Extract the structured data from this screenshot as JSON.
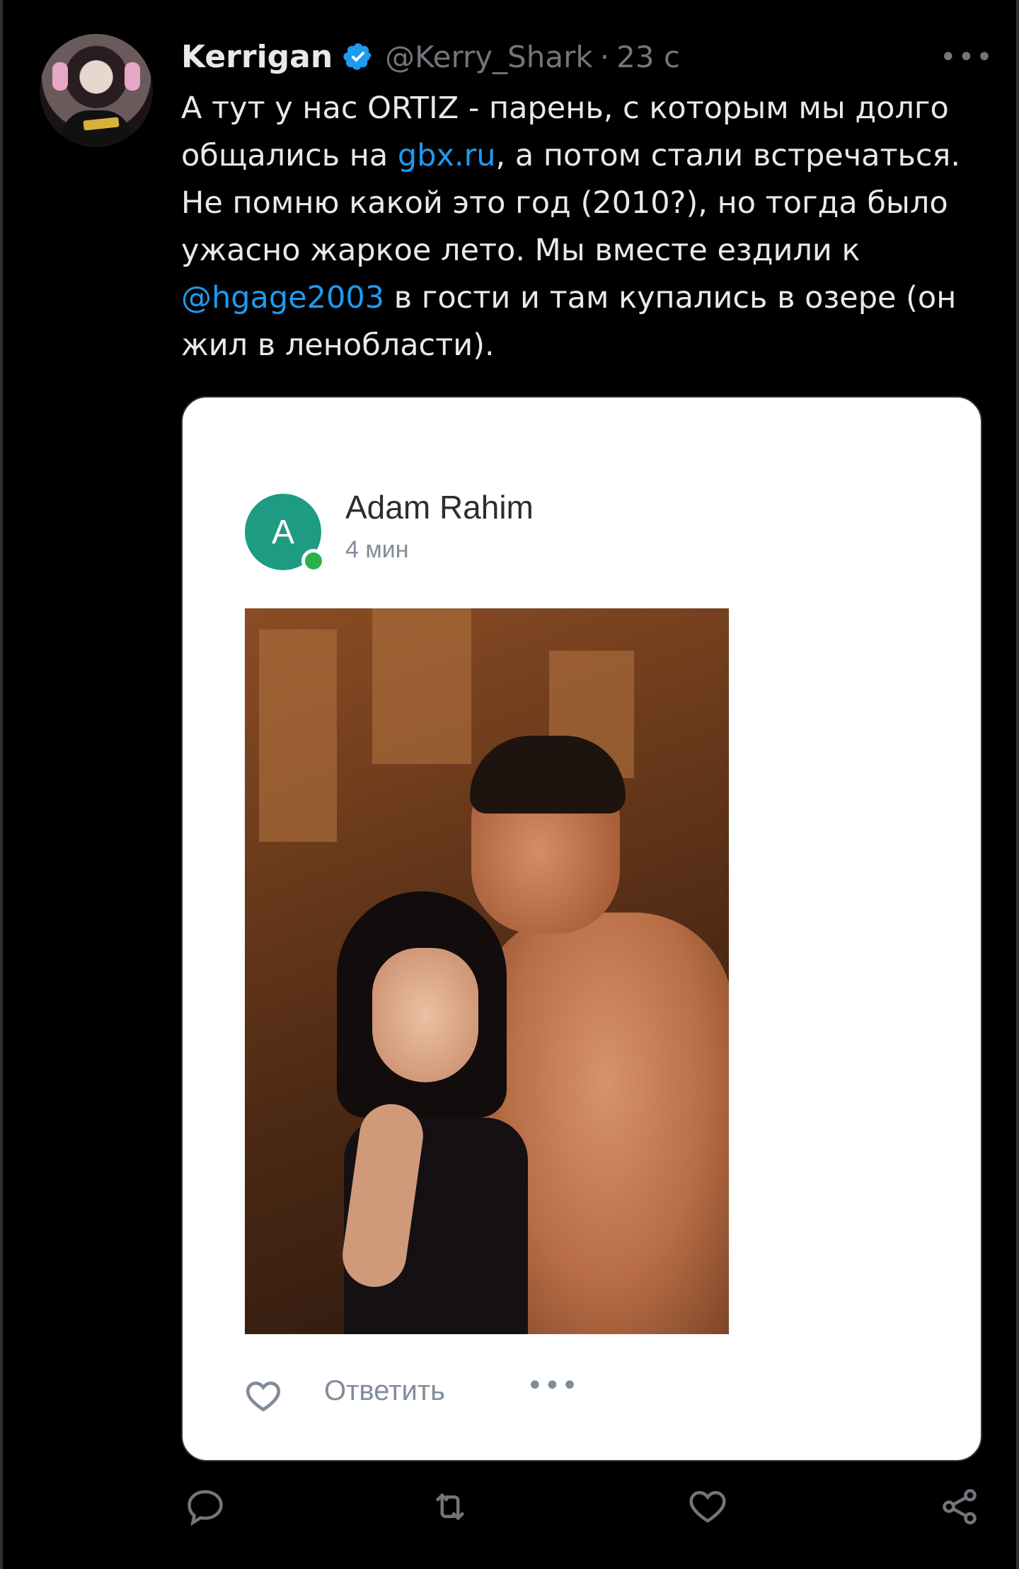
{
  "tweet": {
    "author_name": "Kerrigan",
    "author_handle": "@Kerry_Shark",
    "separator": "·",
    "time": "23 с",
    "more_label": "•••",
    "text_parts": {
      "p1": "А тут у нас ORTIZ - парень, с которым мы долго общались на ",
      "link1": "gbx.ru",
      "p2": ", а потом стали встречаться. Не помню какой это год (2010?), но тогда было ужасно жаркое лето. Мы вместе ездили к ",
      "mention": "@hgage2003",
      "p3": " в гости и там купались в озере (он жил в ленобласти)."
    }
  },
  "embedded_post": {
    "avatar_letter": "A",
    "author": "Adam Rahim",
    "time": "4 мин",
    "reply_label": "Ответить",
    "more_label": "•••"
  },
  "colors": {
    "background": "#000000",
    "text": "#e7e9ea",
    "secondary": "#71767b",
    "link": "#1d9bf0",
    "card_avatar": "#1e9b83",
    "online": "#2ab24a"
  },
  "icons": {
    "verified": "verified-badge-icon",
    "reply": "reply-icon",
    "retweet": "retweet-icon",
    "like": "heart-icon",
    "share": "share-icon"
  }
}
